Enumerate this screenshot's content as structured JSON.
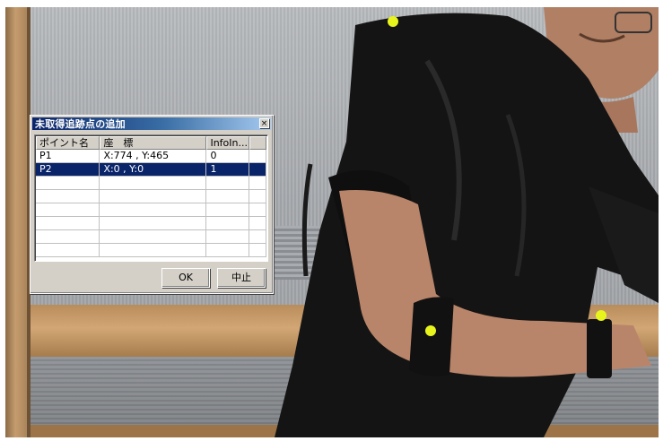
{
  "dialog": {
    "title": "未取得追跡点の追加",
    "close_glyph": "×",
    "columns": [
      "ポイント名",
      "座　標",
      "InfoIn...",
      ""
    ],
    "rows": [
      {
        "name": "P1",
        "coords": "X:774 , Y:465",
        "info": "0"
      },
      {
        "name": "P2",
        "coords": "X:0 , Y:0",
        "info": "1"
      }
    ],
    "selected_row": 1,
    "ok_label": "OK",
    "cancel_label": "中止"
  },
  "colors": {
    "title_bar_start": "#0a246a",
    "title_bar_end": "#a6caf0",
    "selection": "#0a246a",
    "dialog_face": "#d4d0c8",
    "marker": "#e8f51c"
  }
}
